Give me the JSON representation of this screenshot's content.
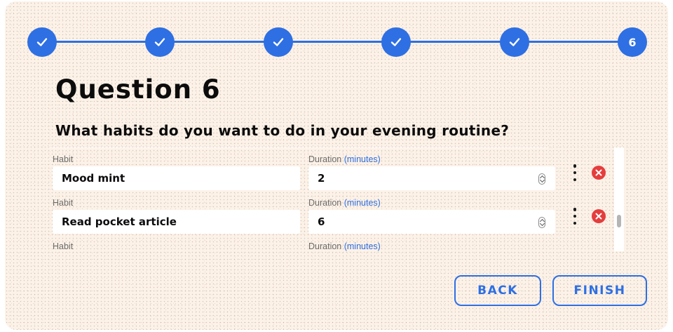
{
  "stepper": {
    "steps": [
      {
        "state": "completed",
        "icon": "check-icon"
      },
      {
        "state": "completed",
        "icon": "check-icon"
      },
      {
        "state": "completed",
        "icon": "check-icon"
      },
      {
        "state": "completed",
        "icon": "check-icon"
      },
      {
        "state": "completed",
        "icon": "check-icon"
      },
      {
        "state": "current",
        "label": "6"
      }
    ],
    "accent_color": "#2e6fe3"
  },
  "title": "Question 6",
  "question": "What habits do you want to do in your evening routine?",
  "habits": {
    "habit_label": "Habit",
    "duration_label": "Duration",
    "duration_unit": "(minutes)",
    "rows": [
      {
        "habit": "Mood mint",
        "duration": "2"
      },
      {
        "habit": "Read pocket article",
        "duration": "6"
      },
      {
        "habit": "",
        "duration": ""
      }
    ]
  },
  "buttons": {
    "back": "BACK",
    "finish": "FINISH"
  },
  "colors": {
    "background": "#fdf2e8",
    "delete": "#e53d3d"
  }
}
